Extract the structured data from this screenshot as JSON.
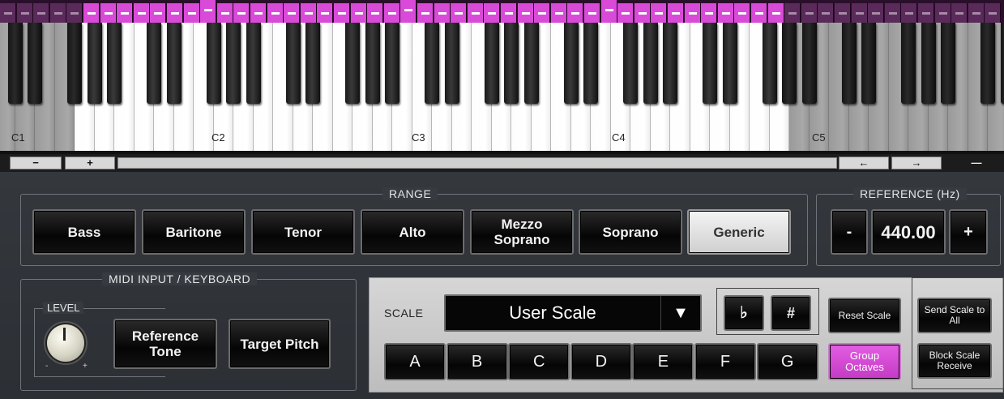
{
  "keyboard": {
    "octave_labels": [
      "C1",
      "C2",
      "C3",
      "C4",
      "C5"
    ],
    "scroll": {
      "zoom_out": "−",
      "zoom_in": "+",
      "left": "←",
      "right": "→",
      "menu": "—"
    }
  },
  "range": {
    "title": "RANGE",
    "buttons": [
      "Bass",
      "Baritone",
      "Tenor",
      "Alto",
      "Mezzo Soprano",
      "Soprano",
      "Generic"
    ],
    "selected": "Generic"
  },
  "reference": {
    "title": "REFERENCE (Hz)",
    "minus": "-",
    "value": "440.00",
    "plus": "+"
  },
  "midi": {
    "title": "MIDI INPUT / KEYBOARD",
    "level_label": "LEVEL",
    "level_min": "-",
    "level_max": "+",
    "reference_tone": "Reference Tone",
    "target_pitch": "Target Pitch"
  },
  "scale": {
    "label": "SCALE",
    "selected": "User Scale",
    "dropdown_arrow": "▼",
    "flat": "♭",
    "sharp": "#",
    "notes": [
      "A",
      "B",
      "C",
      "D",
      "E",
      "F",
      "G"
    ],
    "reset": "Reset Scale",
    "group_octaves": "Group Octaves",
    "send_to_all": "Send Scale to All",
    "block_receive": "Block Scale Receive"
  },
  "colors": {
    "accent": "#d94ad9",
    "strip_bg": "#2a0f2a"
  }
}
